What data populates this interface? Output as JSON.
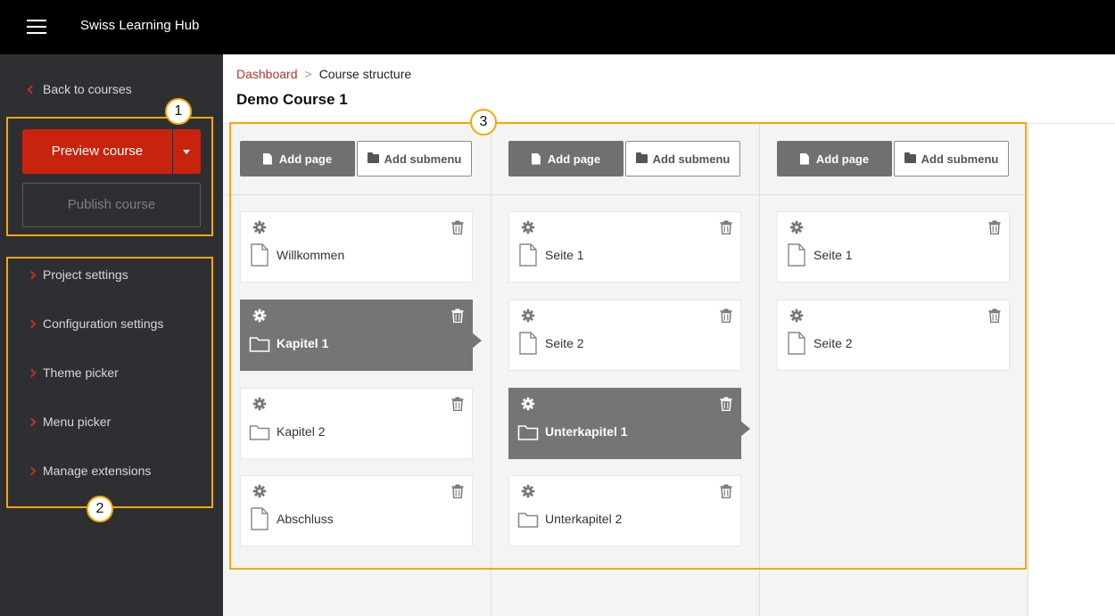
{
  "app": {
    "title": "Swiss Learning Hub"
  },
  "sidebar": {
    "back_label": "Back to courses",
    "preview_label": "Preview course",
    "publish_label": "Publish course",
    "items": [
      {
        "label": "Project settings"
      },
      {
        "label": "Configuration settings"
      },
      {
        "label": "Theme picker"
      },
      {
        "label": "Menu picker"
      },
      {
        "label": "Manage extensions"
      }
    ]
  },
  "breadcrumb": {
    "link": "Dashboard",
    "separator": ">",
    "current": "Course structure"
  },
  "page_title": "Demo Course 1",
  "annotations": [
    "1",
    "2",
    "3"
  ],
  "toolbar": {
    "add_page": "Add page",
    "add_submenu": "Add submenu"
  },
  "columns": [
    {
      "cards": [
        {
          "label": "Willkommen",
          "type": "page",
          "active": false
        },
        {
          "label": "Kapitel 1",
          "type": "folder",
          "active": true
        },
        {
          "label": "Kapitel 2",
          "type": "folder",
          "active": false
        },
        {
          "label": "Abschluss",
          "type": "page",
          "active": false
        }
      ]
    },
    {
      "cards": [
        {
          "label": "Seite 1",
          "type": "page",
          "active": false
        },
        {
          "label": "Seite 2",
          "type": "page",
          "active": false
        },
        {
          "label": "Unterkapitel 1",
          "type": "folder",
          "active": true
        },
        {
          "label": "Unterkapitel 2",
          "type": "folder",
          "active": false
        }
      ]
    },
    {
      "cards": [
        {
          "label": "Seite 1",
          "type": "page",
          "active": false
        },
        {
          "label": "Seite 2",
          "type": "page",
          "active": false
        }
      ]
    }
  ],
  "colors": {
    "accent": "#c8230d",
    "highlight": "#f5a800",
    "sidebar": "#2d2f33",
    "active_card": "#757575"
  }
}
